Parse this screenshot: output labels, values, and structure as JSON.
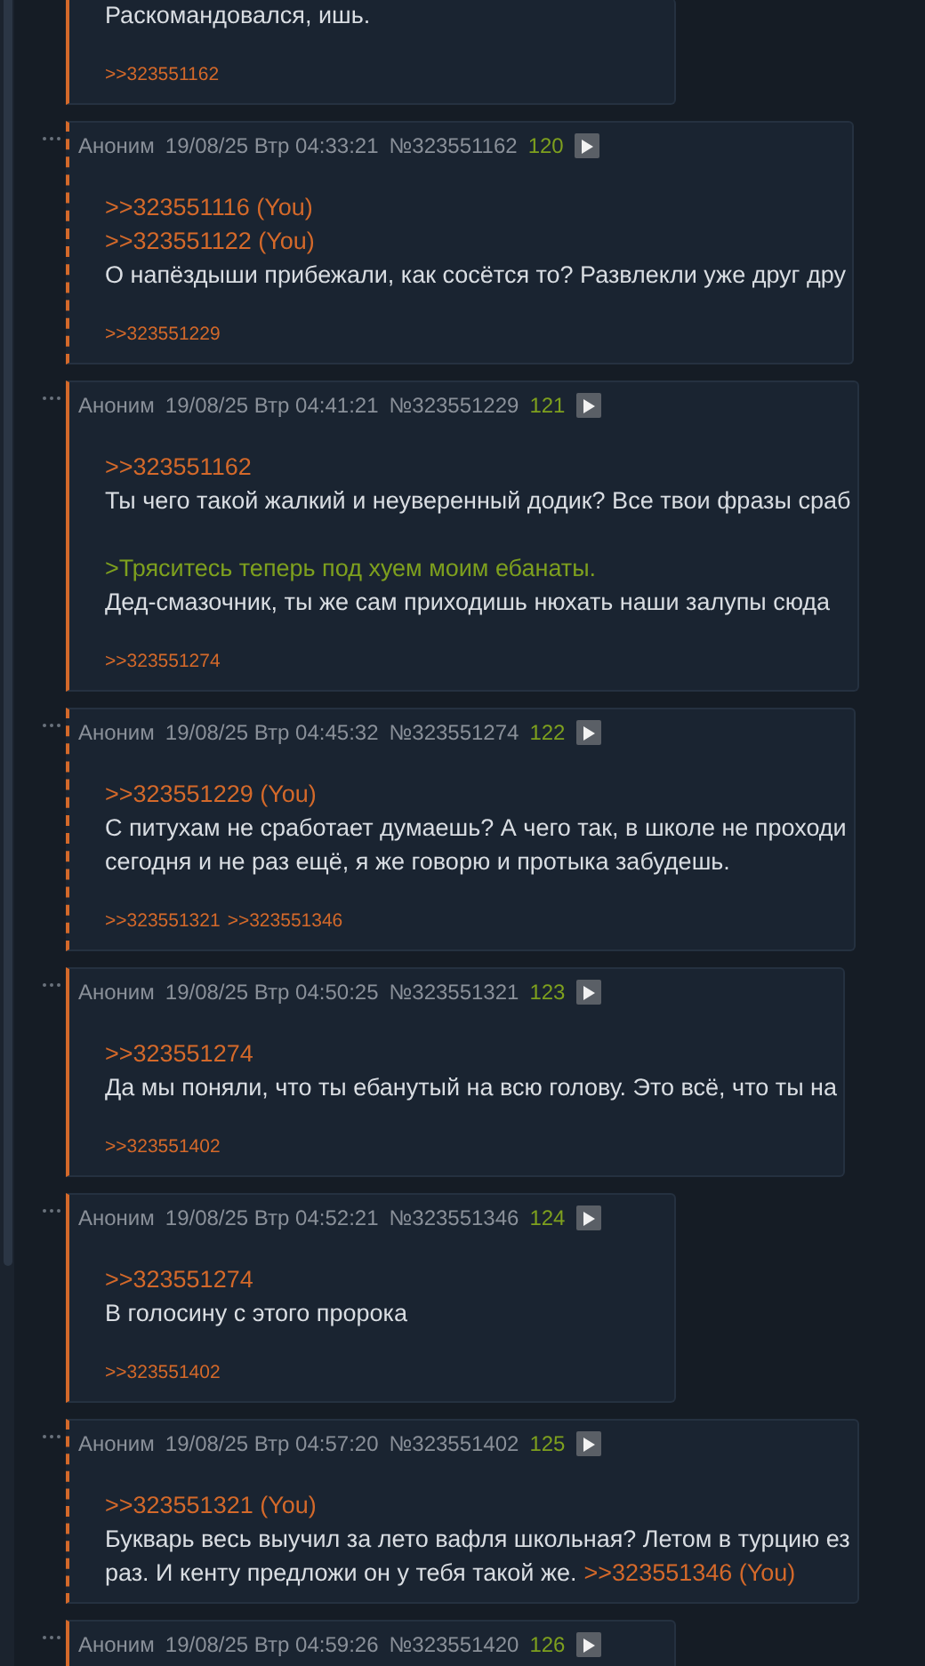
{
  "posts": [
    {
      "partial": true,
      "mentions_you": false,
      "paragraphs": [
        [
          [
            {
              "kind": "text",
              "text": "Раскомандовался, ишь."
            }
          ]
        ]
      ],
      "replies": [
        ">>323551162"
      ]
    },
    {
      "partial": false,
      "mentions_you": true,
      "name": "Аноним",
      "date": "19/08/25 Втр 04:33:21",
      "number": "№323551162",
      "index": "120",
      "paragraphs": [
        [
          [
            {
              "kind": "link",
              "text": ">>323551116 (You)"
            }
          ],
          [
            {
              "kind": "link",
              "text": ">>323551122 (You)"
            }
          ],
          [
            {
              "kind": "text",
              "text": "О напёздыши прибежали, как сосётся то? Развлекли уже друг дру"
            }
          ]
        ]
      ],
      "replies": [
        ">>323551229"
      ]
    },
    {
      "partial": false,
      "mentions_you": false,
      "name": "Аноним",
      "date": "19/08/25 Втр 04:41:21",
      "number": "№323551229",
      "index": "121",
      "paragraphs": [
        [
          [
            {
              "kind": "link",
              "text": ">>323551162"
            }
          ],
          [
            {
              "kind": "text",
              "text": "Ты чего такой жалкий и неуверенный додик? Все твои фразы сраб"
            }
          ]
        ],
        [
          [
            {
              "kind": "quote",
              "text": ">Тряситесь теперь под хуем моим ебанаты."
            }
          ],
          [
            {
              "kind": "text",
              "text": "Дед-смазочник, ты же сам приходишь нюхать наши залупы сюда"
            }
          ]
        ]
      ],
      "replies": [
        ">>323551274"
      ]
    },
    {
      "partial": false,
      "mentions_you": true,
      "name": "Аноним",
      "date": "19/08/25 Втр 04:45:32",
      "number": "№323551274",
      "index": "122",
      "paragraphs": [
        [
          [
            {
              "kind": "link",
              "text": ">>323551229 (You)"
            }
          ],
          [
            {
              "kind": "text",
              "text": "С питухам не сработает думаешь? А чего так, в школе не проходи"
            }
          ],
          [
            {
              "kind": "text",
              "text": "сегодня и не раз ещё, я же говорю и протыка забудешь."
            }
          ]
        ]
      ],
      "replies": [
        ">>323551321",
        ">>323551346"
      ]
    },
    {
      "partial": false,
      "mentions_you": false,
      "name": "Аноним",
      "date": "19/08/25 Втр 04:50:25",
      "number": "№323551321",
      "index": "123",
      "paragraphs": [
        [
          [
            {
              "kind": "link",
              "text": ">>323551274"
            }
          ],
          [
            {
              "kind": "text",
              "text": "Да мы поняли, что ты ебанутый на всю голову. Это всё, что ты на"
            }
          ]
        ]
      ],
      "replies": [
        ">>323551402"
      ]
    },
    {
      "partial": false,
      "mentions_you": false,
      "name": "Аноним",
      "date": "19/08/25 Втр 04:52:21",
      "number": "№323551346",
      "index": "124",
      "paragraphs": [
        [
          [
            {
              "kind": "link",
              "text": ">>323551274"
            }
          ],
          [
            {
              "kind": "text",
              "text": "В голосину с этого пророка"
            }
          ]
        ]
      ],
      "replies": [
        ">>323551402"
      ]
    },
    {
      "partial": false,
      "mentions_you": true,
      "name": "Аноним",
      "date": "19/08/25 Втр 04:57:20",
      "number": "№323551402",
      "index": "125",
      "paragraphs": [
        [
          [
            {
              "kind": "link",
              "text": ">>323551321 (You)"
            }
          ],
          [
            {
              "kind": "text",
              "text": "Букварь весь выучил за лето вафля школьная? Летом в турцию ез"
            }
          ],
          [
            {
              "kind": "text",
              "text": "раз. И кенту предложи он у тебя такой же."
            },
            {
              "kind": "link",
              "text": ">>323551346 (You)"
            }
          ]
        ]
      ]
    },
    {
      "partial": false,
      "mentions_you": false,
      "name": "Аноним",
      "date": "19/08/25 Втр 04:59:26",
      "number": "№323551420",
      "index": "126"
    }
  ]
}
